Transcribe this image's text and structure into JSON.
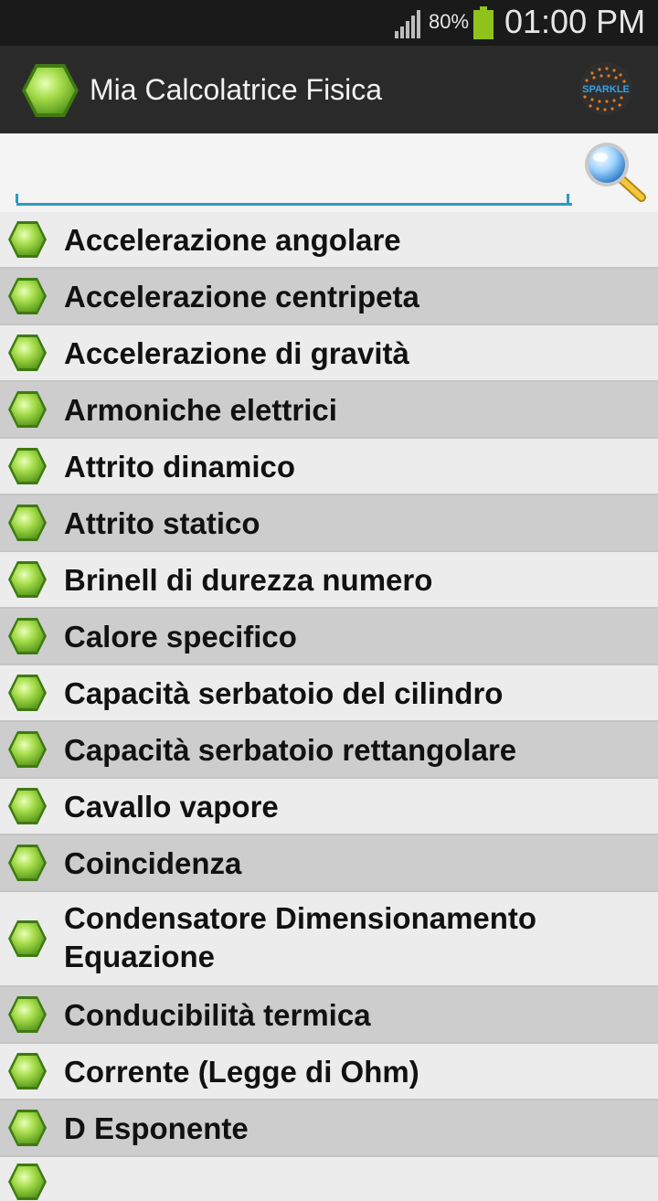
{
  "status_bar": {
    "battery_percent": "80%",
    "time": "01:00 PM"
  },
  "action_bar": {
    "title": "Mia Calcolatrice Fisica",
    "logo_text": "SPARKLE"
  },
  "search": {
    "value": "",
    "placeholder": ""
  },
  "list": {
    "items": [
      {
        "label": "Accelerazione angolare"
      },
      {
        "label": "Accelerazione centripeta"
      },
      {
        "label": "Accelerazione di gravità"
      },
      {
        "label": "Armoniche elettrici"
      },
      {
        "label": "Attrito dinamico"
      },
      {
        "label": "Attrito statico"
      },
      {
        "label": "Brinell di durezza numero"
      },
      {
        "label": "Calore specifico"
      },
      {
        "label": "Capacità serbatoio del cilindro"
      },
      {
        "label": "Capacità serbatoio rettangolare"
      },
      {
        "label": "Cavallo vapore"
      },
      {
        "label": "Coincidenza"
      },
      {
        "label": "Condensatore Dimensionamento Equazione"
      },
      {
        "label": "Conducibilità termica"
      },
      {
        "label": "Corrente (Legge di Ohm)"
      },
      {
        "label": "D Esponente"
      }
    ]
  }
}
